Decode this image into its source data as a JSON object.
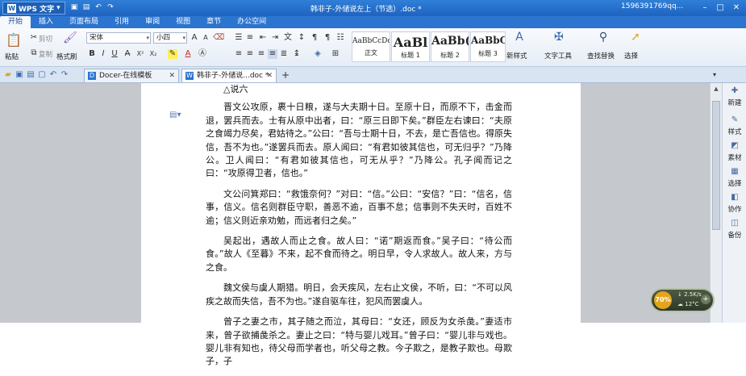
{
  "app": {
    "name": "WPS 文字",
    "logo": "W"
  },
  "title": {
    "document": "韩非子-外储说左上（节选）.doc *",
    "user": "1596391769qq..."
  },
  "menus": [
    "开始",
    "插入",
    "页面布局",
    "引用",
    "审阅",
    "视图",
    "章节",
    "办公空间"
  ],
  "ribbon": {
    "paste": "粘贴",
    "cut": "剪切",
    "copy": "复制",
    "format_painter": "格式刷",
    "font_name": "宋体",
    "font_size": "小四",
    "styles": [
      {
        "preview": "AaBbCcDd",
        "label": "正文"
      },
      {
        "preview": "AaBl",
        "label": "标题 1"
      },
      {
        "preview": "AaBb(",
        "label": "标题 2"
      },
      {
        "preview": "AaBbC",
        "label": "标题 3"
      }
    ],
    "new_style": "新样式",
    "text_tools": "文字工具",
    "find_replace": "查找替换",
    "select": "选择"
  },
  "tabs": [
    {
      "label": "Docer-在线模板",
      "icon": "D"
    },
    {
      "label": "韩非子-外储说...doc *",
      "icon": "W"
    }
  ],
  "document": {
    "heading": "△说六",
    "paragraphs": [
      "晋文公攻原，裹十日粮，遂与大夫期十日。至原十日，而原不下，击金而退，罢兵而去。士有从原中出者，曰：“原三日即下矣。”群臣左右谏曰：“夫原之食竭力尽矣，君姑待之。”公曰：“吾与士期十日，不去，是亡吾信也。得原失信，吾不为也。”遂罢兵而去。原人闻曰：“有君如彼其信也，可无归乎？”乃降公。卫人闻曰：“有君如彼其信也，可无从乎？”乃降公。孔子闻而记之曰：“攻原得卫者，信也。”",
      "文公问箕郑曰：“救饿奈何？”对曰：“信。”公曰：“安信？”曰：“信名，信事，信义。信名则群臣守职，善恶不逾，百事不怠；信事则不失天时，百姓不逾；信义则近亲劝勉，而远者归之矣。”",
      "吴起出，遇故人而止之食。故人曰：“诺”期返而食。”吴子曰：“待公而食。”故人《至暮》不来，起不食而待之。明日早，令人求故人。故人来，方与之食。",
      "魏文侯与虞人期猎。明日，会天疾风，左右止文侯，不听，曰：“不可以风疾之故而失信，吾不为也。”遂自驱车往，犯风而罢虞人。",
      "曾子之妻之市，其子随之而泣，其母曰：“女还，顾反为女杀彘。”妻适市来，曾子欲捕彘杀之。妻止之曰：“特与婴儿戏耳。”曾子曰：“婴儿非与戏也。婴儿非有知也，待父母而学者也，听父母之教。今子欺之，是教子欺也。母欺子，子"
    ]
  },
  "side_panel": [
    "新建",
    "样式",
    "素材",
    "选择",
    "协作",
    "备份"
  ],
  "widget": {
    "percent": "70%",
    "speed": "2.5K/s",
    "temp": "12°C"
  }
}
